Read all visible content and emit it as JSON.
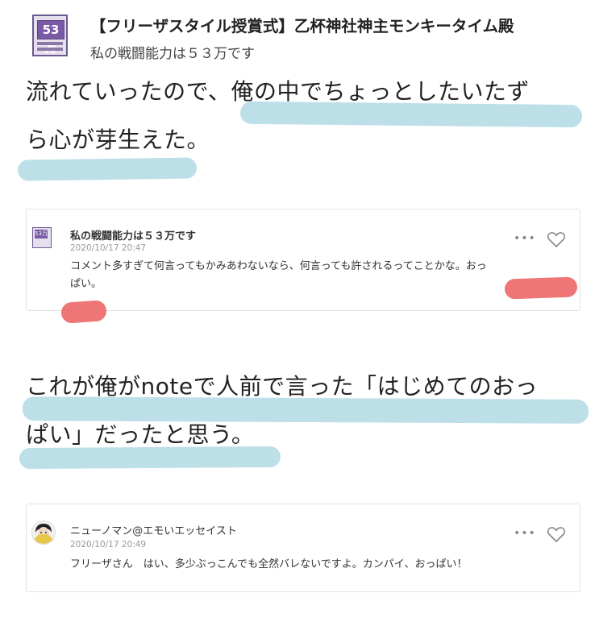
{
  "header": {
    "avatar_text": "53万",
    "title": "【フリーザスタイル授賞式】乙杯神社神主モンキータイム殿",
    "subtitle": "私の戦闘能力は５３万です"
  },
  "article": {
    "para1_line1": "流れていったので、俺の中でちょっとしたいたず",
    "para1_line2": "ら心が芽生えた。",
    "para2_line1": "これが俺がnoteで人前で言った「はじめてのおっ",
    "para2_line2": "ぱい」だったと思う。"
  },
  "comment1": {
    "avatar_text": "53万",
    "name": "私の戦闘能力は５３万です",
    "date": "2020/10/17 20:47",
    "line1": "コメント多すぎて何言ってもかみあわないなら、何言っても許されるってことかな。おっ",
    "line2": "ぱい。",
    "more": "•••"
  },
  "comment2": {
    "name": "ニューノマン@エモいエッセイスト",
    "date": "2020/10/17 20:49",
    "text": "フリーザさん　はい、多少ぶっこんでも全然バレないですよ。カンパイ、おっぱい！",
    "more": "•••"
  },
  "colors": {
    "highlight_blue": "#b6dbe6",
    "highlight_red": "#ee6a6a"
  }
}
